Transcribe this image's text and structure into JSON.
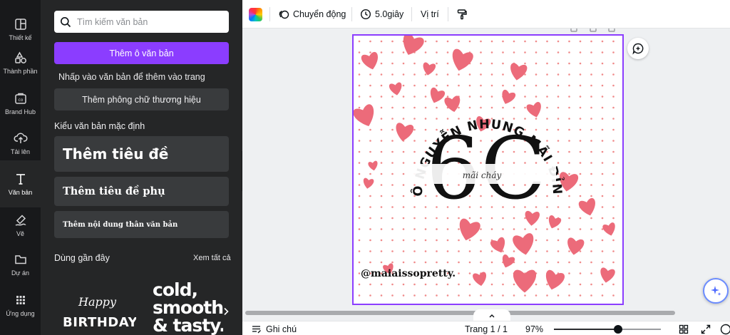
{
  "rail": {
    "items": [
      {
        "label": "Thiết kế",
        "icon": "layout-icon"
      },
      {
        "label": "Thành phần",
        "icon": "shapes-icon"
      },
      {
        "label": "Brand Hub",
        "icon": "brand-icon"
      },
      {
        "label": "Tải lên",
        "icon": "upload-icon"
      },
      {
        "label": "Văn bản",
        "icon": "text-icon",
        "active": true
      },
      {
        "label": "Vẽ",
        "icon": "draw-icon"
      },
      {
        "label": "Dự án",
        "icon": "folder-icon"
      },
      {
        "label": "Ứng dụng",
        "icon": "apps-grid-icon"
      }
    ]
  },
  "panel": {
    "search_placeholder": "Tìm kiếm văn bản",
    "add_textbox": "Thêm ô văn bản",
    "hint": "Nhấp vào văn bản để thêm vào trang",
    "add_brand_font": "Thêm phông chữ thương hiệu",
    "default_styles_title": "Kiểu văn bản mặc định",
    "heading": "Thêm tiêu đề",
    "subheading": "Thêm tiêu đề phụ",
    "body": "Thêm nội dung thân văn bản",
    "recent_title": "Dùng gần đây",
    "see_all": "Xem tất cả",
    "recent": {
      "birthday_top": "Happy",
      "birthday_bottom": "BIRTHDAY",
      "cold_lines": [
        "cold,",
        "smooth",
        "& tasty."
      ]
    }
  },
  "toolbar": {
    "animate": "Chuyển động",
    "duration": "5.0giây",
    "position": "Vị trí"
  },
  "design": {
    "arc_text": "CÔ NGUYỄN NHUNG MÃI ĐỈNH",
    "big_text": "6C",
    "script_text": "mãi cháy",
    "handle": "@maiaissopretty.",
    "colors": {
      "heart": "#ec6b7a",
      "dot": "#f08a8a",
      "selection": "#8b3dff"
    }
  },
  "bottombar": {
    "notes": "Ghi chú",
    "page": "Trang 1 / 1",
    "zoom": "97%",
    "zoom_value": 0.6
  }
}
